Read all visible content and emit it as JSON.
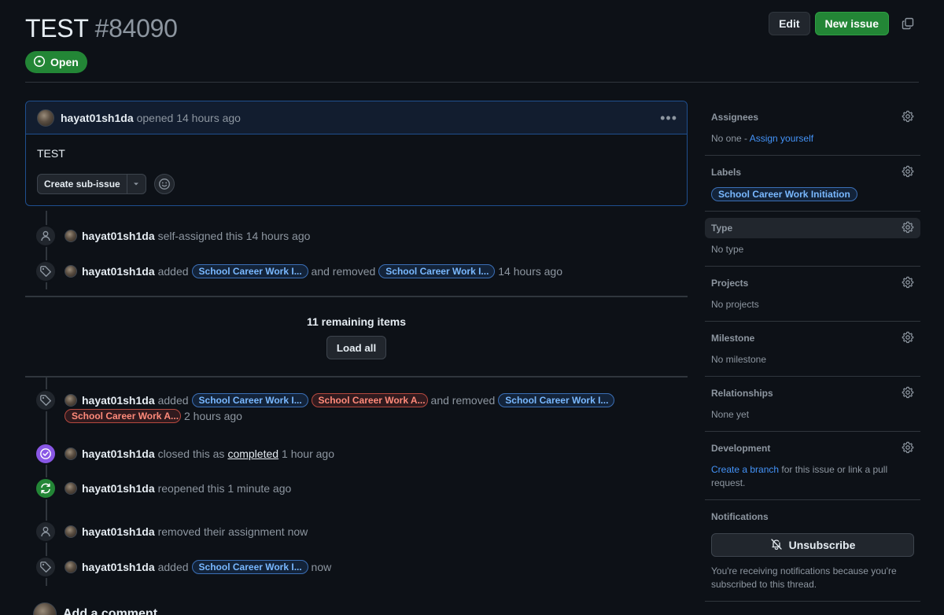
{
  "issue": {
    "title": "TEST",
    "number": "#84090",
    "state": "Open"
  },
  "header": {
    "edit_label": "Edit",
    "new_issue_label": "New issue"
  },
  "comment": {
    "author": "hayat01sh1da",
    "meta": "opened 14 hours ago",
    "body": "TEST",
    "create_sub_issue_label": "Create sub-issue"
  },
  "events_top": [
    {
      "icon": "person-icon",
      "author": "hayat01sh1da",
      "text": "self-assigned this 14 hours ago"
    },
    {
      "icon": "tag-icon",
      "author": "hayat01sh1da",
      "added_word": "added",
      "added_label": "School Career Work I...",
      "removed_word": "and removed",
      "removed_label": "School Career Work I...",
      "time": "14 hours ago"
    }
  ],
  "remaining": {
    "count_text": "11 remaining items",
    "load_all_label": "Load all"
  },
  "events_bottom": {
    "e1": {
      "author": "hayat01sh1da",
      "added_word": "added",
      "label_a": "School Career Work I...",
      "label_b": "School Career Work A...",
      "removed_word": "and removed",
      "label_c": "School Career Work I...",
      "label_d": "School Career Work A...",
      "time": "2 hours ago"
    },
    "e2": {
      "author": "hayat01sh1da",
      "pre": "closed this as",
      "link": "completed",
      "time": "1 hour ago"
    },
    "e3": {
      "author": "hayat01sh1da",
      "text": "reopened this 1 minute ago"
    },
    "e4": {
      "author": "hayat01sh1da",
      "text": "removed their assignment now"
    },
    "e5": {
      "author": "hayat01sh1da",
      "added_word": "added",
      "label": "School Career Work I...",
      "time": "now"
    }
  },
  "add_comment_label": "Add a comment",
  "sidebar": {
    "assignees": {
      "title": "Assignees",
      "value_prefix": "No one -",
      "value_link": "Assign yourself"
    },
    "labels": {
      "title": "Labels",
      "label": "School Career Work Initiation"
    },
    "type": {
      "title": "Type",
      "value": "No type"
    },
    "projects": {
      "title": "Projects",
      "value": "No projects"
    },
    "milestone": {
      "title": "Milestone",
      "value": "No milestone"
    },
    "relationships": {
      "title": "Relationships",
      "value": "None yet"
    },
    "development": {
      "title": "Development",
      "link": "Create a branch",
      "rest": "for this issue or link a pull request."
    },
    "notifications": {
      "title": "Notifications",
      "button": "Unsubscribe",
      "note": "You're receiving notifications because you're subscribed to this thread."
    }
  },
  "colors": {
    "bg": "#0d1117",
    "accent_green": "#238636",
    "link_blue": "#4493f8",
    "label_blue": "#79b8ff",
    "label_red": "#ff8a7a",
    "closed_purple": "#8957e5"
  }
}
